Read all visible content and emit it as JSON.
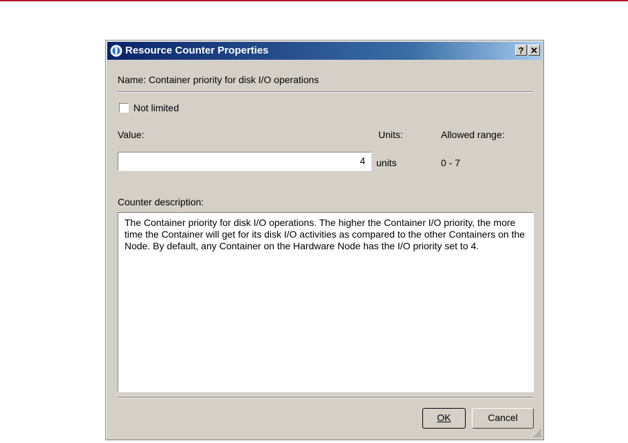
{
  "window": {
    "title": "Resource Counter Properties",
    "help_label": "?",
    "close_label": "✕"
  },
  "name_line": "Name:  Container priority for disk I/O operations",
  "not_limited": {
    "label": "Not limited",
    "checked": false
  },
  "value": {
    "label": "Value:",
    "current": "4"
  },
  "units": {
    "label": "Units:",
    "value": "units"
  },
  "allowed_range": {
    "label": "Allowed range:",
    "value": "0 - 7"
  },
  "description": {
    "label": "Counter description:",
    "text": "The Container priority for disk I/O operations. The higher the Container I/O priority, the more time the Container will get for its disk I/O activities as compared to the other Containers on the Node. By default, any Container on the Hardware Node has the I/O priority set to 4."
  },
  "buttons": {
    "ok": "OK",
    "cancel": "Cancel"
  },
  "colors": {
    "titlebar_start": "#0a246a",
    "titlebar_end": "#a6caf0",
    "dialog_face": "#d4d0c8",
    "top_rule": "#b0172b"
  }
}
